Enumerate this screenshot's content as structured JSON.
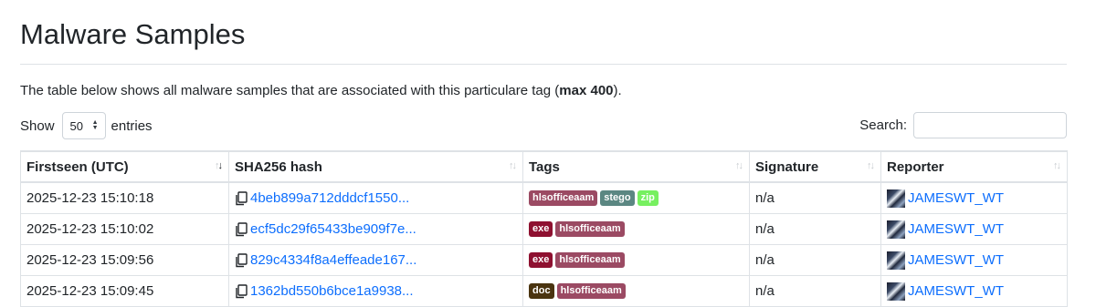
{
  "page": {
    "title": "Malware Samples",
    "description_prefix": "The table below shows all malware samples that are associated with this particulare tag (",
    "description_bold": "max 400",
    "description_suffix": ")."
  },
  "controls": {
    "show_label": "Show",
    "page_length": "50",
    "entries_label": "entries",
    "search_label": "Search:",
    "search_value": ""
  },
  "table": {
    "columns": [
      "Firstseen (UTC)",
      "SHA256 hash",
      "Tags",
      "Signature",
      "Reporter"
    ],
    "rows": [
      {
        "firstseen": "2025-12-23 15:10:18",
        "hash": "4beb899a712dddcf1550...",
        "tags": [
          {
            "label": "hlsofficeaam",
            "color": "#9b4a63"
          },
          {
            "label": "stego",
            "color": "#5b8782"
          },
          {
            "label": "zip",
            "color": "#77f060"
          }
        ],
        "signature": "n/a",
        "reporter": "JAMESWT_WT"
      },
      {
        "firstseen": "2025-12-23 15:10:02",
        "hash": "ecf5dc29f65433be909f7e...",
        "tags": [
          {
            "label": "exe",
            "color": "#8e1030"
          },
          {
            "label": "hlsofficeaam",
            "color": "#9b4a63"
          }
        ],
        "signature": "n/a",
        "reporter": "JAMESWT_WT"
      },
      {
        "firstseen": "2025-12-23 15:09:56",
        "hash": "829c4334f8a4effeade167...",
        "tags": [
          {
            "label": "exe",
            "color": "#8e1030"
          },
          {
            "label": "hlsofficeaam",
            "color": "#9b4a63"
          }
        ],
        "signature": "n/a",
        "reporter": "JAMESWT_WT"
      },
      {
        "firstseen": "2025-12-23 15:09:45",
        "hash": "1362bd550b6bce1a9938...",
        "tags": [
          {
            "label": "doc",
            "color": "#4a3410"
          },
          {
            "label": "hlsofficeaam",
            "color": "#9b4a63"
          }
        ],
        "signature": "n/a",
        "reporter": "JAMESWT_WT"
      }
    ]
  },
  "colors": {
    "link": "#0d6efd",
    "text": "#212529",
    "border": "#dee2e6"
  },
  "icons": {
    "copy": "copy-icon",
    "avatar": "reporter-avatar",
    "sort": "sort-arrows-icon"
  }
}
